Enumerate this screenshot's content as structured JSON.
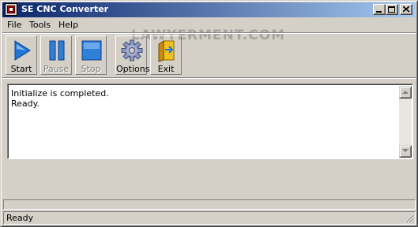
{
  "window": {
    "title": "SE CNC Converter",
    "icon": "app-icon",
    "caption_buttons": [
      "minimize-icon",
      "maximize-icon",
      "close-icon"
    ]
  },
  "menu": {
    "items": [
      {
        "label": "File"
      },
      {
        "label": "Tools"
      },
      {
        "label": "Help"
      }
    ]
  },
  "watermark": "LAWYERMENT.COM",
  "toolbar": {
    "buttons": [
      {
        "label": "Start",
        "icon": "play-icon",
        "enabled": true
      },
      {
        "label": "Pause",
        "icon": "pause-icon",
        "enabled": false
      },
      {
        "label": "Stop",
        "icon": "stop-icon",
        "enabled": false
      },
      {
        "label": "Options",
        "icon": "gear-icon",
        "enabled": true
      },
      {
        "label": "Exit",
        "icon": "door-exit-icon",
        "enabled": true
      }
    ]
  },
  "log": {
    "lines": [
      "Initialize is completed.",
      "Ready."
    ]
  },
  "progress": {
    "fraction": 0
  },
  "status": {
    "text": "Ready"
  },
  "colors": {
    "titlebar_start": "#0a246a",
    "titlebar_end": "#a6caf0",
    "face": "#d4d0c8",
    "icon_blue": "#1f74d6"
  }
}
